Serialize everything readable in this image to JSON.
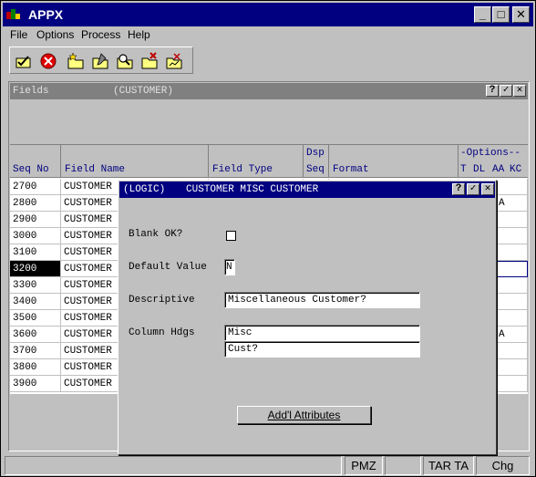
{
  "window": {
    "title": "APPX"
  },
  "menu": [
    "File",
    "Options",
    "Process",
    "Help"
  ],
  "toolbar": {
    "icons": [
      "check-folder-icon",
      "cancel-circle-icon",
      "folder-star-icon",
      "folder-edit-icon",
      "folder-search-icon",
      "folder-delete-icon",
      "folder-chart-icon"
    ]
  },
  "fields_window": {
    "title": "Fields",
    "subtitle": "(CUSTOMER)"
  },
  "columns": {
    "seq_no": "Seq No",
    "field_name": "Field Name",
    "field_type": "Field Type",
    "dsp": "Dsp",
    "seq": "Seq",
    "format": "Format",
    "options": "-Options--",
    "t": "T",
    "dl": "DL",
    "aa": "AA",
    "kc": "KC"
  },
  "rows": [
    {
      "seq": "2700",
      "name": "CUSTOMER",
      "aa": ""
    },
    {
      "seq": "2800",
      "name": "CUSTOMER",
      "aa": "A"
    },
    {
      "seq": "2900",
      "name": "CUSTOMER",
      "aa": ""
    },
    {
      "seq": "3000",
      "name": "CUSTOMER",
      "aa": ""
    },
    {
      "seq": "3100",
      "name": "CUSTOMER",
      "aa": ""
    },
    {
      "seq": "3200",
      "name": "CUSTOMER",
      "aa": ""
    },
    {
      "seq": "3300",
      "name": "CUSTOMER",
      "aa": ""
    },
    {
      "seq": "3400",
      "name": "CUSTOMER",
      "aa": ""
    },
    {
      "seq": "3500",
      "name": "CUSTOMER",
      "aa": ""
    },
    {
      "seq": "3600",
      "name": "CUSTOMER",
      "aa": "A"
    },
    {
      "seq": "3700",
      "name": "CUSTOMER",
      "aa": ""
    },
    {
      "seq": "3800",
      "name": "CUSTOMER",
      "aa": ""
    },
    {
      "seq": "3900",
      "name": "CUSTOMER",
      "aa": ""
    }
  ],
  "selected_row": "3200",
  "dialog": {
    "title_tag": "(LOGIC)",
    "title": "CUSTOMER MISC CUSTOMER",
    "blank_ok_label": "Blank OK?",
    "default_value_label": "Default Value",
    "default_value": "N",
    "descriptive_label": "Descriptive",
    "descriptive_value": "Miscellaneous Customer?",
    "column_hdgs_label": "Column Hdgs",
    "column_hdg_1": "Misc",
    "column_hdg_2": "Cust?",
    "attributes_button": "Add'l Attributes"
  },
  "status": {
    "s1": "PMZ",
    "s2": "TAR TA",
    "s3": "Chg"
  },
  "colors": {
    "titlebar": "#000080",
    "inactive_title": "#808080",
    "face": "#c0c0c0"
  }
}
